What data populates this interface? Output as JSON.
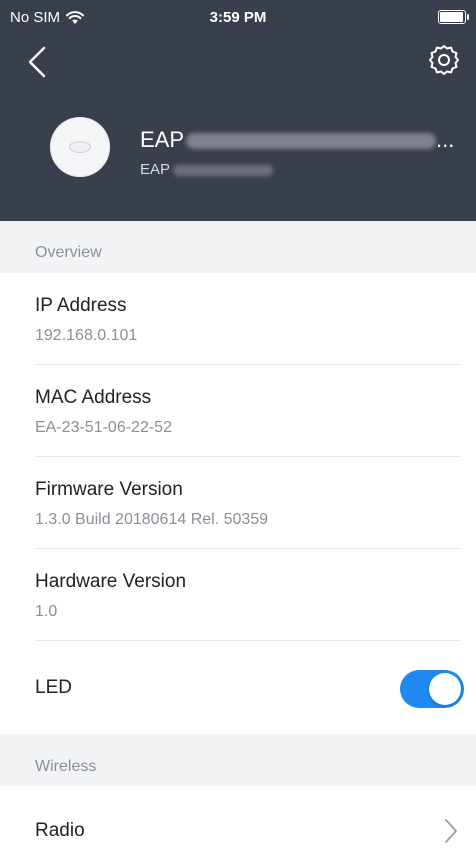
{
  "status_bar": {
    "carrier": "No SIM",
    "time": "3:59 PM"
  },
  "header": {
    "device_name": "EAP",
    "device_name_suffix": "...",
    "device_model": "EAP"
  },
  "sections": {
    "overview": "Overview",
    "wireless": "Wireless"
  },
  "overview_items": [
    {
      "label": "IP Address",
      "value": "192.168.0.101"
    },
    {
      "label": "MAC Address",
      "value": "EA-23-51-06-22-52"
    },
    {
      "label": "Firmware Version",
      "value": "1.3.0 Build 20180614 Rel. 50359"
    },
    {
      "label": "Hardware Version",
      "value": "1.0"
    }
  ],
  "led": {
    "label": "LED",
    "enabled": true
  },
  "wireless_items": [
    {
      "label": "Radio"
    }
  ],
  "colors": {
    "header_bg": "#3a3f4d",
    "accent": "#1e8af0"
  }
}
